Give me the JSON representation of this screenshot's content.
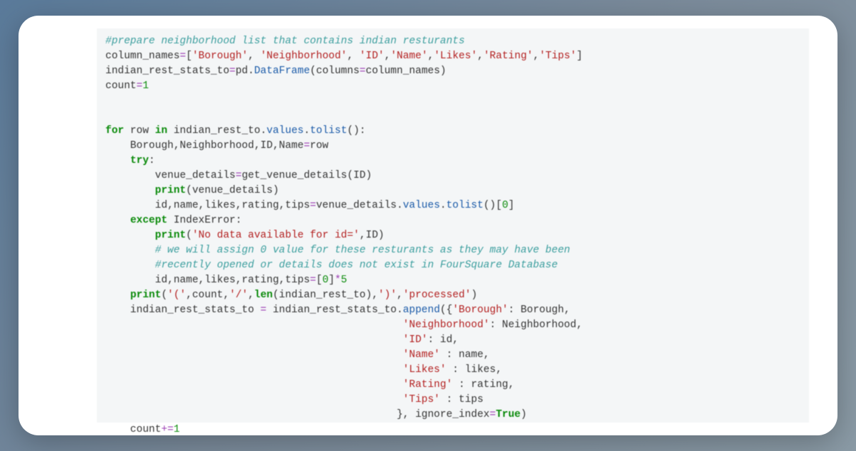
{
  "code": {
    "line1": "#prepare neighborhood list that contains indian resturants",
    "line2_a": "column_names",
    "line2_b": "=",
    "line2_c": "[",
    "line2_d": "'Borough'",
    "line2_e": ", ",
    "line2_f": "'Neighborhood'",
    "line2_g": ", ",
    "line2_h": "'ID'",
    "line2_i": ",",
    "line2_j": "'Name'",
    "line2_k": ",",
    "line2_l": "'Likes'",
    "line2_m": ",",
    "line2_n": "'Rating'",
    "line2_o": ",",
    "line2_p": "'Tips'",
    "line2_q": "]",
    "line3_a": "indian_rest_stats_to",
    "line3_b": "=",
    "line3_c": "pd",
    "line3_d": ".",
    "line3_e": "DataFrame",
    "line3_f": "(columns",
    "line3_g": "=",
    "line3_h": "column_names)",
    "line4_a": "count",
    "line4_b": "=",
    "line4_c": "1",
    "line6_a": "for",
    "line6_b": " row ",
    "line6_c": "in",
    "line6_d": " indian_rest_to",
    "line6_e": ".",
    "line6_f": "values",
    "line6_g": ".",
    "line6_h": "tolist",
    "line6_i": "():",
    "line7": "    Borough,Neighborhood,ID,Name",
    "line7_b": "=",
    "line7_c": "row",
    "line8_a": "    ",
    "line8_b": "try",
    "line8_c": ":",
    "line9_a": "        venue_details",
    "line9_b": "=",
    "line9_c": "get_venue_details(ID)",
    "line10_a": "        ",
    "line10_b": "print",
    "line10_c": "(venue_details)",
    "line11_a": "        id,name,likes,rating,tips",
    "line11_b": "=",
    "line11_c": "venue_details",
    "line11_d": ".",
    "line11_e": "values",
    "line11_f": ".",
    "line11_g": "tolist",
    "line11_h": "()[",
    "line11_i": "0",
    "line11_j": "]",
    "line12_a": "    ",
    "line12_b": "except",
    "line12_c": " IndexError:",
    "line13_a": "        ",
    "line13_b": "print",
    "line13_c": "(",
    "line13_d": "'No data available for id='",
    "line13_e": ",ID)",
    "line14": "        # we will assign 0 value for these resturants as they may have been",
    "line15": "        #recently opened or details does not exist in FourSquare Database",
    "line16_a": "        id,name,likes,rating,tips",
    "line16_b": "=",
    "line16_c": "[",
    "line16_d": "0",
    "line16_e": "]",
    "line16_f": "*",
    "line16_g": "5",
    "line17_a": "    ",
    "line17_b": "print",
    "line17_c": "(",
    "line17_d": "'('",
    "line17_e": ",count,",
    "line17_f": "'/'",
    "line17_g": ",",
    "line17_h": "len",
    "line17_i": "(indian_rest_to),",
    "line17_j": "')'",
    "line17_k": ",",
    "line17_l": "'processed'",
    "line17_m": ")",
    "line18_a": "    indian_rest_stats_to ",
    "line18_b": "=",
    "line18_c": " indian_rest_stats_to",
    "line18_d": ".",
    "line18_e": "append",
    "line18_f": "({",
    "line18_g": "'Borough'",
    "line18_h": ": Borough,",
    "line19_a": "                                                ",
    "line19_b": "'Neighborhood'",
    "line19_c": ": Neighborhood,",
    "line20_a": "                                                ",
    "line20_b": "'ID'",
    "line20_c": ": id,",
    "line21_a": "                                                ",
    "line21_b": "'Name'",
    "line21_c": " : name,",
    "line22_a": "                                                ",
    "line22_b": "'Likes'",
    "line22_c": " : likes,",
    "line23_a": "                                                ",
    "line23_b": "'Rating'",
    "line23_c": " : rating,",
    "line24_a": "                                                ",
    "line24_b": "'Tips'",
    "line24_c": " : tips",
    "line25_a": "                                               }, ignore_index",
    "line25_b": "=",
    "line25_c": "True",
    "line25_d": ")",
    "line26_a": "    count",
    "line26_b": "+=",
    "line26_c": "1"
  }
}
